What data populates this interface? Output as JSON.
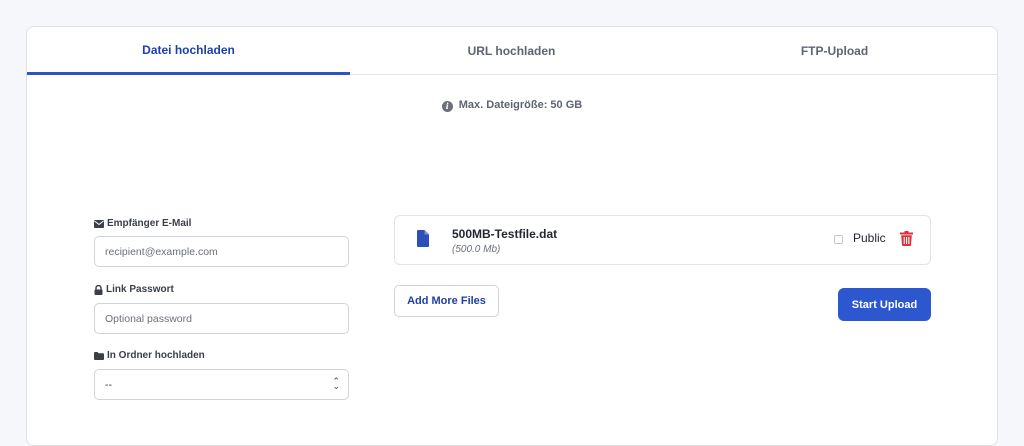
{
  "tabs": [
    {
      "label": "Datei hochladen",
      "active": true
    },
    {
      "label": "URL hochladen",
      "active": false
    },
    {
      "label": "FTP-Upload",
      "active": false
    }
  ],
  "info": {
    "text": "Max. Dateigröße: 50 GB",
    "icon": "info-icon"
  },
  "form": {
    "email": {
      "label": "Empfänger E-Mail",
      "icon": "envelope-icon",
      "placeholder": "recipient@example.com"
    },
    "password": {
      "label": "Link Passwort",
      "icon": "lock-icon",
      "placeholder": "Optional password"
    },
    "folder": {
      "label": "In Ordner hochladen",
      "icon": "folder-icon",
      "value": "--"
    }
  },
  "file": {
    "name": "500MB-Testfile.dat",
    "size": "(500.0 Mb)",
    "public_label": "Public",
    "public_checked": false,
    "icon": "file-icon"
  },
  "buttons": {
    "add_more": "Add More Files",
    "start_upload": "Start Upload"
  },
  "colors": {
    "accent": "#2d57cf",
    "tab_active": "#1f3fa8",
    "delete": "#d9323b"
  }
}
